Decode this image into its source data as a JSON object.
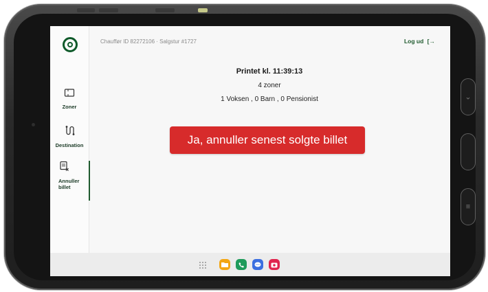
{
  "app": {
    "header": "Chauffør ID 82272106 · Salgstur #1727",
    "logout": "Log ud"
  },
  "sidebar": {
    "items": [
      {
        "label": "Zoner",
        "icon": "ticket-icon"
      },
      {
        "label": "Destination",
        "icon": "route-icon"
      },
      {
        "label_line1": "Annuller",
        "label_line2": "billet",
        "icon": "receipt-cancel-icon",
        "active": true
      }
    ]
  },
  "ticket": {
    "printed": "Printet kl. 11:39:13",
    "zones": "4 zoner",
    "passengers": "1 Voksen , 0 Barn , 0 Pensionist"
  },
  "actions": {
    "cancel_label": "Ja, annuller senest solgte billet"
  },
  "taskbar": {
    "apps": [
      "app-grid-icon",
      "folder-app-icon",
      "phone-app-icon",
      "messages-app-icon",
      "camera-app-icon"
    ]
  },
  "colors": {
    "brand_green": "#1f5a2e",
    "danger_red": "#d72b2b"
  }
}
